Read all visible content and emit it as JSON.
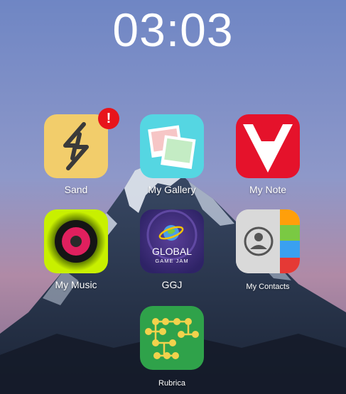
{
  "clock": {
    "time": "03:03"
  },
  "apps": {
    "sand": {
      "label": "Sand",
      "icon": "lightning-bolt-icon",
      "color": "#f2c94c",
      "badge": "!"
    },
    "gallery": {
      "label": "My Gallery",
      "icon": "photos-icon",
      "color": "#52d4e0"
    },
    "note": {
      "label": "My Note",
      "icon": "v-logo-icon",
      "color": "#e5122b"
    },
    "music": {
      "label": "My Music",
      "icon": "speaker-icon",
      "color": "#c8f000"
    },
    "ggj": {
      "label": "GGJ",
      "icon": "global-game-jam-logo",
      "color": "#3d2f7a",
      "logo_line1": "GLOBAL",
      "logo_line2": "GAME JAM"
    },
    "contacts": {
      "label": "My Contacts",
      "icon": "contacts-book-icon",
      "color": "#d8d8d8"
    },
    "rubrica": {
      "label": "Rubrica",
      "icon": "org-chart-icon",
      "color": "#2fa24a"
    }
  }
}
